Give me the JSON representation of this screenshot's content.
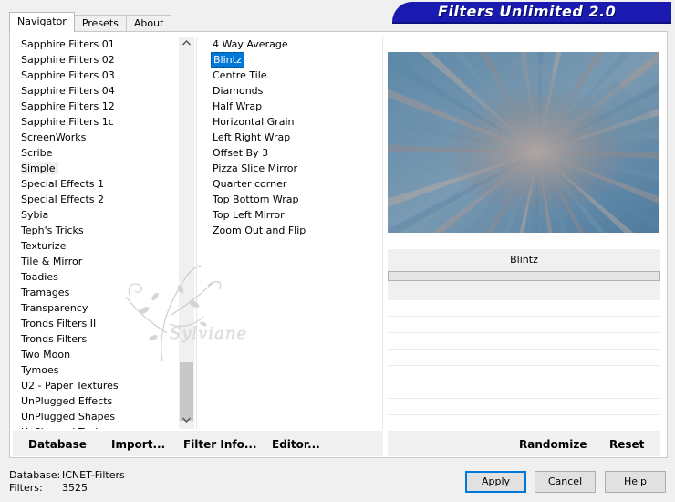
{
  "banner": {
    "title": "Filters Unlimited 2.0"
  },
  "tabs": [
    {
      "label": "Navigator",
      "active": true
    },
    {
      "label": "Presets",
      "active": false
    },
    {
      "label": "About",
      "active": false
    }
  ],
  "categories": {
    "items": [
      "Sapphire Filters 01",
      "Sapphire Filters 02",
      "Sapphire Filters 03",
      "Sapphire Filters 04",
      "Sapphire Filters 12",
      "Sapphire Filters 1c",
      "ScreenWorks",
      "Scribe",
      "Simple",
      "Special Effects 1",
      "Special Effects 2",
      "Sybia",
      "Teph's Tricks",
      "Texturize",
      "Tile & Mirror",
      "Toadies",
      "Tramages",
      "Transparency",
      "Tronds Filters II",
      "Tronds Filters",
      "Two Moon",
      "Tymoes",
      "U2 - Paper Textures",
      "UnPlugged Effects",
      "UnPlugged Shapes",
      "UnPlugged Tools"
    ],
    "selected": "Simple"
  },
  "filters": {
    "items": [
      "4 Way Average",
      "Blintz",
      "Centre Tile",
      "Diamonds",
      "Half Wrap",
      "Horizontal Grain",
      "Left Right Wrap",
      "Offset By 3",
      "Pizza Slice Mirror",
      "Quarter corner",
      "Top Bottom Wrap",
      "Top Left Mirror",
      "Zoom Out and Flip"
    ],
    "selected": "Blintz"
  },
  "preview": {
    "filter_name": "Blintz"
  },
  "buttons": {
    "database": "Database",
    "import": "Import...",
    "filter_info": "Filter Info...",
    "editor": "Editor...",
    "randomize": "Randomize",
    "reset": "Reset",
    "apply": "Apply",
    "cancel": "Cancel",
    "help": "Help"
  },
  "footer": {
    "database_label": "Database:",
    "database_value": "ICNET-Filters",
    "filters_label": "Filters:",
    "filters_value": "3525"
  },
  "watermark": {
    "text": "Sylviane"
  },
  "icons": {
    "scroll_up": "chevron-up-icon",
    "scroll_down": "chevron-down-icon"
  }
}
